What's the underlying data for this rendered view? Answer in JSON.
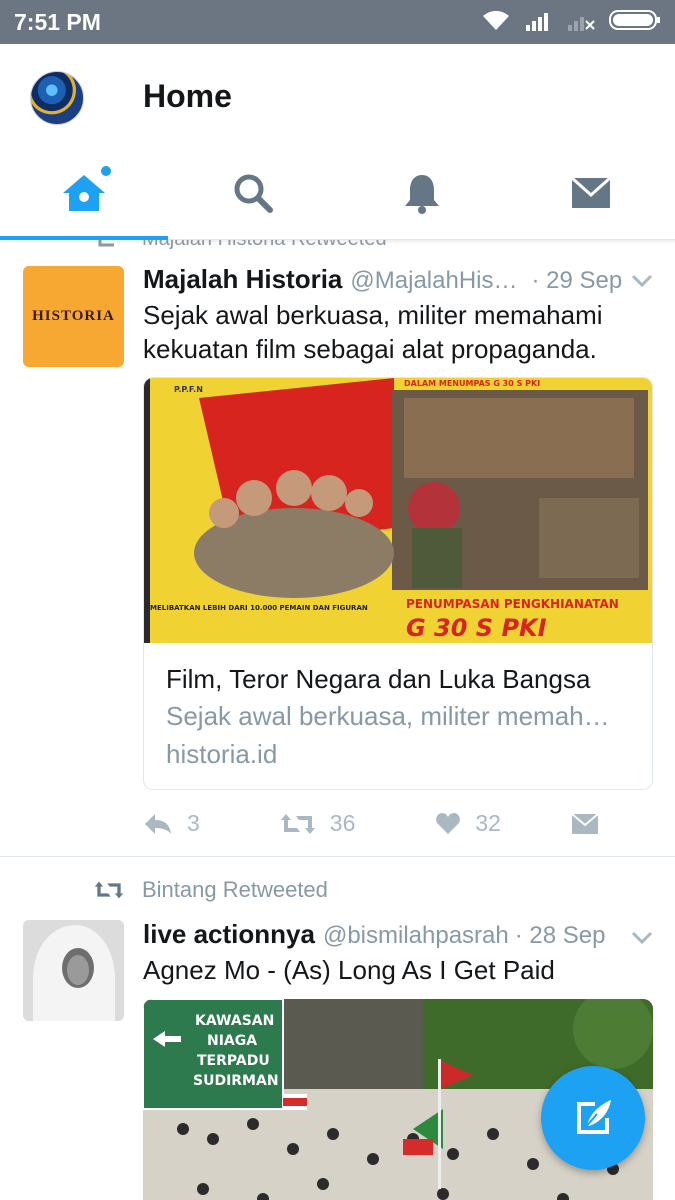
{
  "status_bar": {
    "time": "7:51 PM",
    "icons": [
      "wifi-icon",
      "signal-icon",
      "no-signal-icon",
      "battery-icon"
    ]
  },
  "app_bar": {
    "title": "Home"
  },
  "tabs": [
    {
      "name": "home",
      "icon": "home-icon",
      "active": true
    },
    {
      "name": "search",
      "icon": "search-icon",
      "active": false
    },
    {
      "name": "notifications",
      "icon": "bell-icon",
      "active": false
    },
    {
      "name": "messages",
      "icon": "envelope-icon",
      "active": false
    }
  ],
  "tweets": [
    {
      "context": "Majalah Historia Retweeted",
      "avatar_text": "HISTORIA",
      "name": "Majalah Historia",
      "handle": "@MajalahHis…",
      "time": "· 29 Sep",
      "text": "Sejak awal berkuasa, militer memahami kekuatan film sebagai alat propaganda.",
      "card": {
        "image_texts": {
          "top_left": "P.P.F.N",
          "top_right": "DALAM MENUMPAS G 30 S PKI",
          "bottom_left": "MELIBATKAN LEBIH DARI 10.000 PEMAIN DAN FIGURAN",
          "bottom_right_1": "PENUMPASAN PENGKHIANATAN",
          "bottom_right_2": "G 30 S PKI"
        },
        "title": "Film, Teror Negara dan Luka Bangsa",
        "description": "Sejak awal berkuasa, militer memah…",
        "domain": "historia.id"
      },
      "actions": {
        "replies": "3",
        "retweets": "36",
        "likes": "32"
      }
    },
    {
      "context": "Bintang Retweeted",
      "name": "live actionnya",
      "handle": "@bismilahpasrah",
      "time": "· 28 Sep",
      "text": "Agnez Mo - (As) Long As I Get Paid",
      "media_sign": [
        "KAWASAN",
        "NIAGA",
        "TERPADU",
        "SUDIRMAN"
      ]
    }
  ],
  "fab": {
    "icon": "compose-icon"
  },
  "colors": {
    "accent": "#1da1f2",
    "muted": "#8899a6",
    "status_bar": "#6b7682"
  }
}
